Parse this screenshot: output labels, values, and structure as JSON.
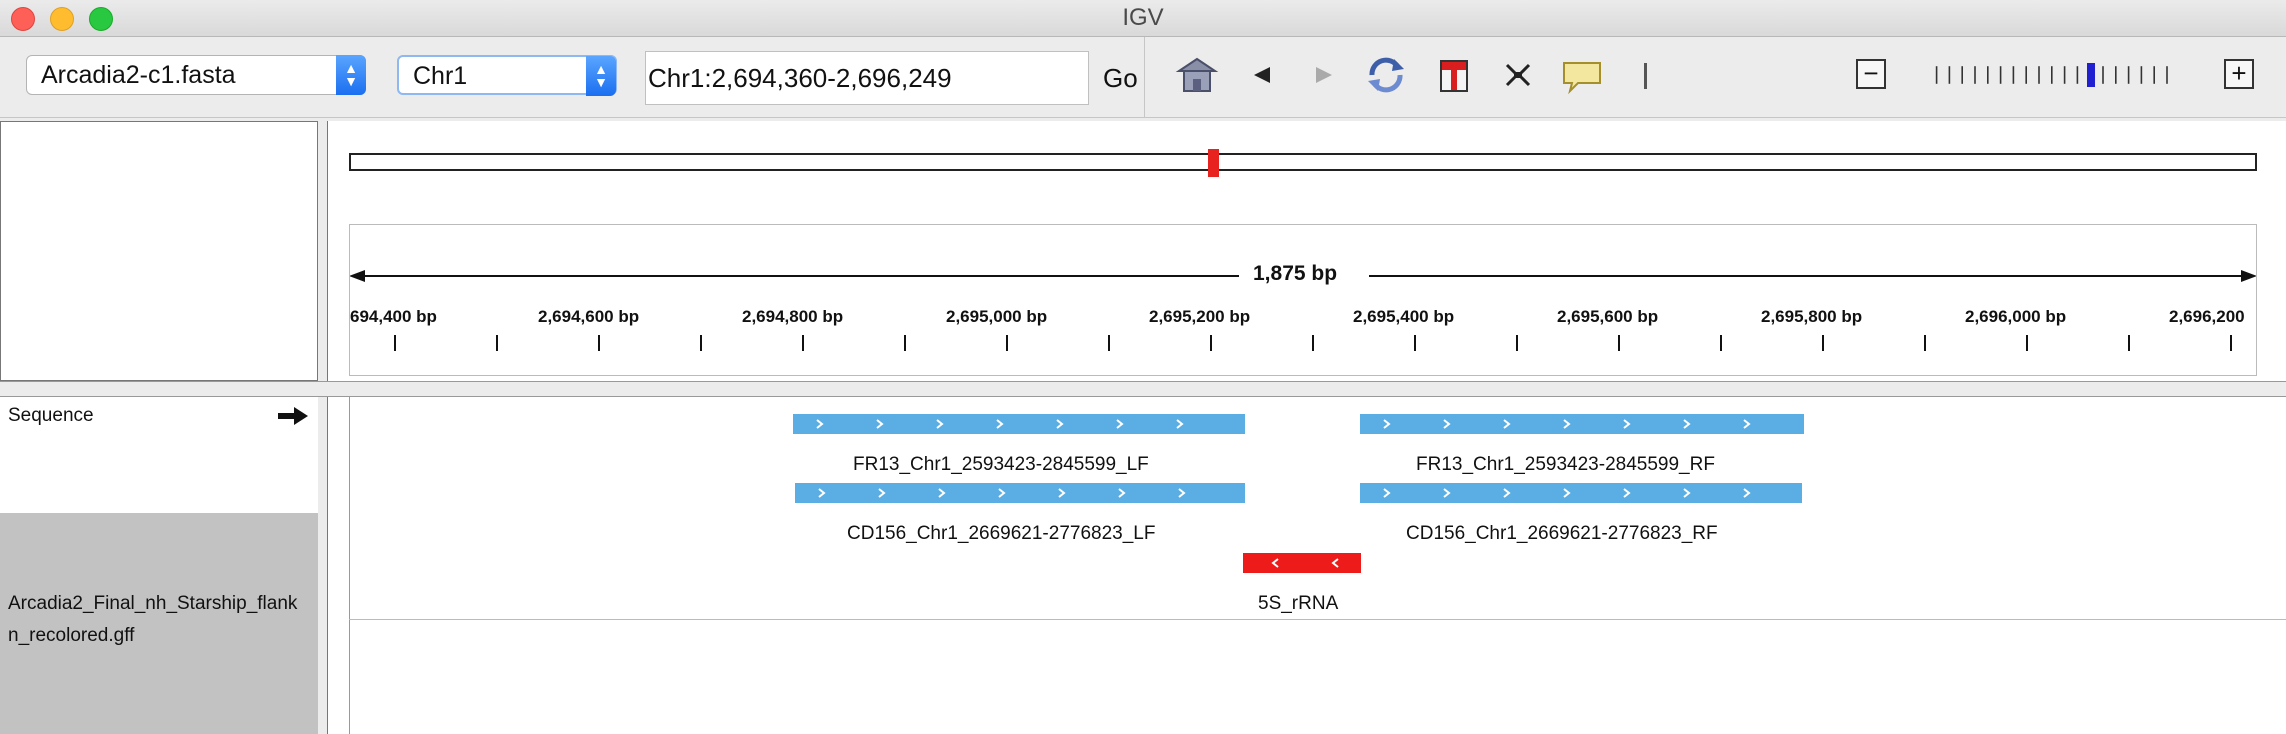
{
  "window": {
    "title": "IGV"
  },
  "toolbar": {
    "genome": "Arcadia2-c1.fasta",
    "chromosome": "Chr1",
    "locus": "Chr1:2,694,360-2,696,249",
    "go_label": "Go"
  },
  "ideogram": {
    "current_region_color": "#e8231f"
  },
  "ruler": {
    "span_label": "1,875 bp",
    "ticks": [
      "694,400 bp",
      "2,694,600 bp",
      "2,694,800 bp",
      "2,695,000 bp",
      "2,695,200 bp",
      "2,695,400 bp",
      "2,695,600 bp",
      "2,695,800 bp",
      "2,696,000 bp",
      "2,696,200"
    ]
  },
  "tracks": {
    "sequence_label": "Sequence",
    "gff_label_line1": "Arcadia2_Final_nh_Starship_flank",
    "gff_label_line2": "n_recolored.gff"
  },
  "features": [
    {
      "name": "FR13_Chr1_2593423-2845599_LF",
      "color": "#5aaee3",
      "strand": "+"
    },
    {
      "name": "FR13_Chr1_2593423-2845599_RF",
      "color": "#5aaee3",
      "strand": "+"
    },
    {
      "name": "CD156_Chr1_2669621-2776823_LF",
      "color": "#5aaee3",
      "strand": "+"
    },
    {
      "name": "CD156_Chr1_2669621-2776823_RF",
      "color": "#5aaee3",
      "strand": "+"
    },
    {
      "name": "5S_rRNA",
      "color": "#ee1b1b",
      "strand": "-"
    }
  ]
}
